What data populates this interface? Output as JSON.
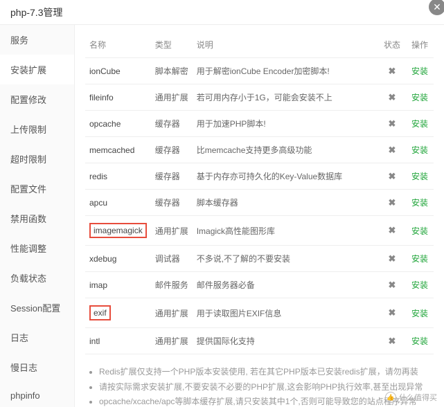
{
  "header": {
    "title": "php-7.3管理"
  },
  "sidebar": {
    "items": [
      {
        "label": "服务"
      },
      {
        "label": "安装扩展"
      },
      {
        "label": "配置修改"
      },
      {
        "label": "上传限制"
      },
      {
        "label": "超时限制"
      },
      {
        "label": "配置文件"
      },
      {
        "label": "禁用函数"
      },
      {
        "label": "性能调整"
      },
      {
        "label": "负载状态"
      },
      {
        "label": "Session配置"
      },
      {
        "label": "日志"
      },
      {
        "label": "慢日志"
      },
      {
        "label": "phpinfo"
      }
    ]
  },
  "table": {
    "headers": {
      "name": "名称",
      "type": "类型",
      "desc": "说明",
      "status": "状态",
      "action": "操作"
    },
    "rows": [
      {
        "name": "ionCube",
        "type": "脚本解密",
        "desc": "用于解密ionCube Encoder加密脚本!",
        "hl": false
      },
      {
        "name": "fileinfo",
        "type": "通用扩展",
        "desc": "若可用内存小于1G，可能会安装不上",
        "hl": false
      },
      {
        "name": "opcache",
        "type": "缓存器",
        "desc": "用于加速PHP脚本!",
        "hl": false
      },
      {
        "name": "memcached",
        "type": "缓存器",
        "desc": "比memcache支持更多高级功能",
        "hl": false
      },
      {
        "name": "redis",
        "type": "缓存器",
        "desc": "基于内存亦可持久化的Key-Value数据库",
        "hl": false
      },
      {
        "name": "apcu",
        "type": "缓存器",
        "desc": "脚本缓存器",
        "hl": false
      },
      {
        "name": "imagemagick",
        "type": "通用扩展",
        "desc": "Imagick高性能图形库",
        "hl": true
      },
      {
        "name": "xdebug",
        "type": "调试器",
        "desc": "不多说,不了解的不要安装",
        "hl": false
      },
      {
        "name": "imap",
        "type": "邮件服务",
        "desc": "邮件服务器必备",
        "hl": false
      },
      {
        "name": "exif",
        "type": "通用扩展",
        "desc": "用于读取图片EXIF信息",
        "hl": true
      },
      {
        "name": "intl",
        "type": "通用扩展",
        "desc": "提供国际化支持",
        "hl": false
      }
    ],
    "status_icon": "✖",
    "install_label": "安装"
  },
  "notes": [
    "Redis扩展仅支持一个PHP版本安装使用, 若在其它PHP版本已安装redis扩展，请勿再装",
    "请按实际需求安装扩展,不要安装不必要的PHP扩展,这会影响PHP执行效率,甚至出现异常",
    "opcache/xcache/apc等脚本缓存扩展,请只安装其中1个,否则可能导致您的站点程序异常"
  ],
  "watermark": "什么值得买"
}
